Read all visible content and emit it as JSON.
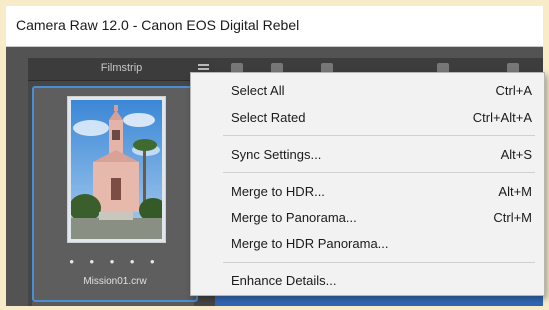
{
  "window": {
    "title": "Camera Raw 12.0  -  Canon EOS Digital Rebel"
  },
  "filmstrip": {
    "title": "Filmstrip",
    "selected_image": {
      "filename": "Mission01.crw",
      "rating_dots": "• • • • •"
    }
  },
  "context_menu": {
    "items": [
      {
        "label": "Select All",
        "shortcut": "Ctrl+A"
      },
      {
        "label": "Select Rated",
        "shortcut": "Ctrl+Alt+A"
      },
      {
        "label": "Sync Settings...",
        "shortcut": "Alt+S"
      },
      {
        "label": "Merge to HDR...",
        "shortcut": "Alt+M"
      },
      {
        "label": "Merge to Panorama...",
        "shortcut": "Ctrl+M"
      },
      {
        "label": "Merge to HDR Panorama...",
        "shortcut": ""
      },
      {
        "label": "Enhance Details...",
        "shortcut": ""
      }
    ]
  },
  "colors": {
    "app_background": "#535353",
    "selection_border": "#4a8fd6",
    "menu_background": "#f2f2f2",
    "page_background": "#f7ebc8"
  },
  "icons": [
    "hamburger-icon",
    "sync-icon",
    "toolbar-icon"
  ]
}
